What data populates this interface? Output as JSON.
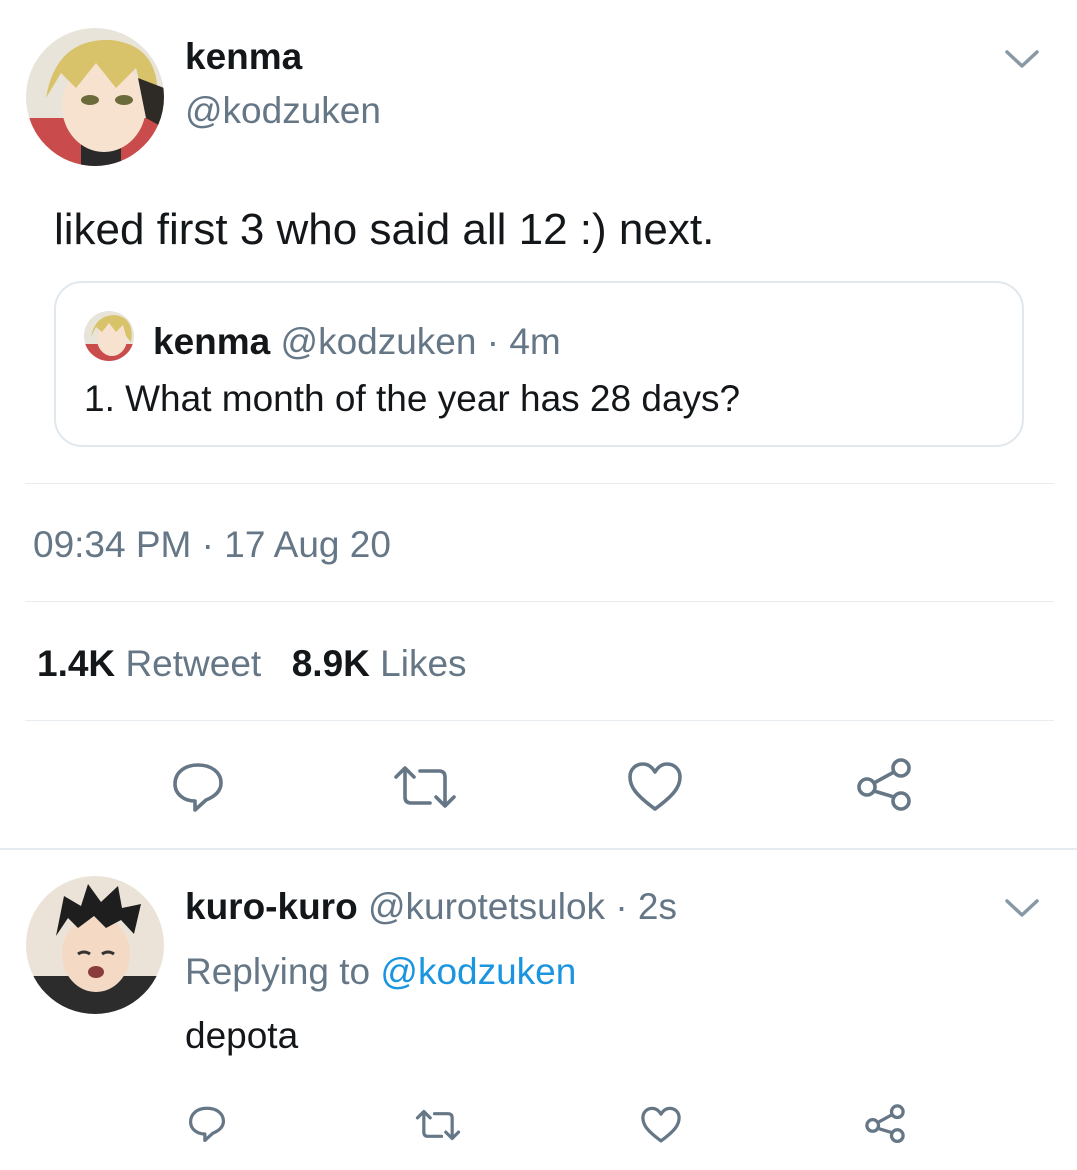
{
  "tweet": {
    "display_name": "kenma",
    "handle": "@kodzuken",
    "text": "liked first 3 who said all 12 :) next.",
    "menu_icon": "chevron-down-icon",
    "quoted": {
      "display_name": "kenma",
      "handle": "@kodzuken",
      "separator": "·",
      "time": "4m",
      "text": "1. What month of the year has 28 days?"
    },
    "timestamp": "09:34 PM · 17 Aug 20",
    "stats": {
      "retweets_count": "1.4K",
      "retweets_label": "Retweet",
      "likes_count": "8.9K",
      "likes_label": "Likes"
    },
    "actions": [
      "reply-icon",
      "retweet-icon",
      "like-icon",
      "share-icon"
    ]
  },
  "reply": {
    "display_name": "kuro-kuro",
    "handle": "@kurotetsulok",
    "separator": "·",
    "time": "2s",
    "replying_to_label": "Replying to",
    "replying_to_handle": "@kodzuken",
    "text": "depota",
    "menu_icon": "chevron-down-icon",
    "actions": [
      "reply-icon",
      "retweet-icon",
      "like-icon",
      "share-icon"
    ]
  },
  "colors": {
    "text": "#14171a",
    "secondary": "#657786",
    "link": "#1b95e0",
    "divider": "#e6ecf0",
    "icon": "#657786"
  }
}
